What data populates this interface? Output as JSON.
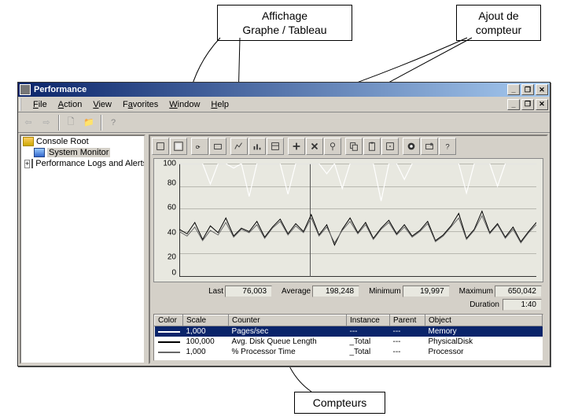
{
  "callouts": {
    "graph": "Affichage\nGraphe / Tableau",
    "add": "Ajout de\ncompteur",
    "counters": "Compteurs"
  },
  "window": {
    "title": "Performance",
    "menu": {
      "file": "File",
      "action": "Action",
      "view": "View",
      "favorites": "Favorites",
      "window": "Window",
      "help": "Help"
    },
    "tree": {
      "root": "Console Root",
      "sysmon": "System Monitor",
      "perflogs": "Performance Logs and Alerts"
    },
    "chart": {
      "yticks": [
        "100",
        "80",
        "60",
        "40",
        "20",
        "0"
      ]
    },
    "stats": {
      "last_l": "Last",
      "last_v": "76,003",
      "avg_l": "Average",
      "avg_v": "198,248",
      "min_l": "Minimum",
      "min_v": "19,997",
      "max_l": "Maximum",
      "max_v": "650,042",
      "dur_l": "Duration",
      "dur_v": "1:40"
    },
    "table": {
      "headers": {
        "color": "Color",
        "scale": "Scale",
        "counter": "Counter",
        "instance": "Instance",
        "parent": "Parent",
        "object": "Object"
      },
      "rows": [
        {
          "color": "#fff",
          "scale": "1,000",
          "counter": "Pages/sec",
          "instance": "---",
          "parent": "---",
          "object": "Memory",
          "sel": true
        },
        {
          "color": "#000",
          "scale": "100,000",
          "counter": "Avg. Disk Queue Length",
          "instance": "_Total",
          "parent": "---",
          "object": "PhysicalDisk",
          "sel": false
        },
        {
          "color": "#666",
          "scale": "1,000",
          "counter": "% Processor Time",
          "instance": "_Total",
          "parent": "---",
          "object": "Processor",
          "sel": false
        }
      ]
    }
  },
  "chart_data": {
    "type": "line",
    "ylim": [
      0,
      100
    ],
    "yticks": [
      0,
      20,
      40,
      60,
      80,
      100
    ],
    "stats": {
      "last": 76.003,
      "average": 198.248,
      "minimum": 19.997,
      "maximum": 650.042,
      "duration": "1:40"
    },
    "series": [
      {
        "name": "Pages/sec",
        "scale": 1000,
        "object": "Memory",
        "instance": "---",
        "parent": "---",
        "values": [
          100,
          100,
          100,
          100,
          82,
          100,
          100,
          96,
          100,
          71,
          100,
          100,
          100,
          100,
          73,
          100,
          100,
          100,
          100,
          91,
          100,
          78,
          100,
          100,
          100,
          100,
          67,
          100,
          100,
          86,
          100,
          100,
          100,
          100,
          100,
          100,
          100,
          74,
          100,
          100,
          100,
          80,
          100,
          100,
          100,
          100,
          100
        ]
      },
      {
        "name": "Avg. Disk Queue Length",
        "scale": 100000,
        "object": "PhysicalDisk",
        "instance": "_Total",
        "parent": "---",
        "values": [
          42,
          38,
          48,
          33,
          45,
          39,
          52,
          36,
          43,
          40,
          49,
          35,
          44,
          51,
          38,
          47,
          40,
          55,
          37,
          46,
          28,
          42,
          52,
          39,
          48,
          34,
          43,
          50,
          38,
          46,
          36,
          41,
          49,
          32,
          37,
          45,
          56,
          34,
          42,
          58,
          39,
          47,
          35,
          44,
          31,
          40,
          48
        ]
      },
      {
        "name": "% Processor Time",
        "scale": 1000,
        "object": "Processor",
        "instance": "_Total",
        "parent": "---",
        "values": [
          40,
          36,
          44,
          32,
          41,
          37,
          48,
          35,
          42,
          39,
          46,
          34,
          43,
          49,
          37,
          45,
          39,
          52,
          36,
          44,
          30,
          41,
          49,
          38,
          46,
          33,
          42,
          48,
          37,
          44,
          35,
          40,
          47,
          31,
          36,
          44,
          52,
          33,
          41,
          54,
          38,
          46,
          34,
          42,
          30,
          39,
          46
        ]
      }
    ]
  }
}
